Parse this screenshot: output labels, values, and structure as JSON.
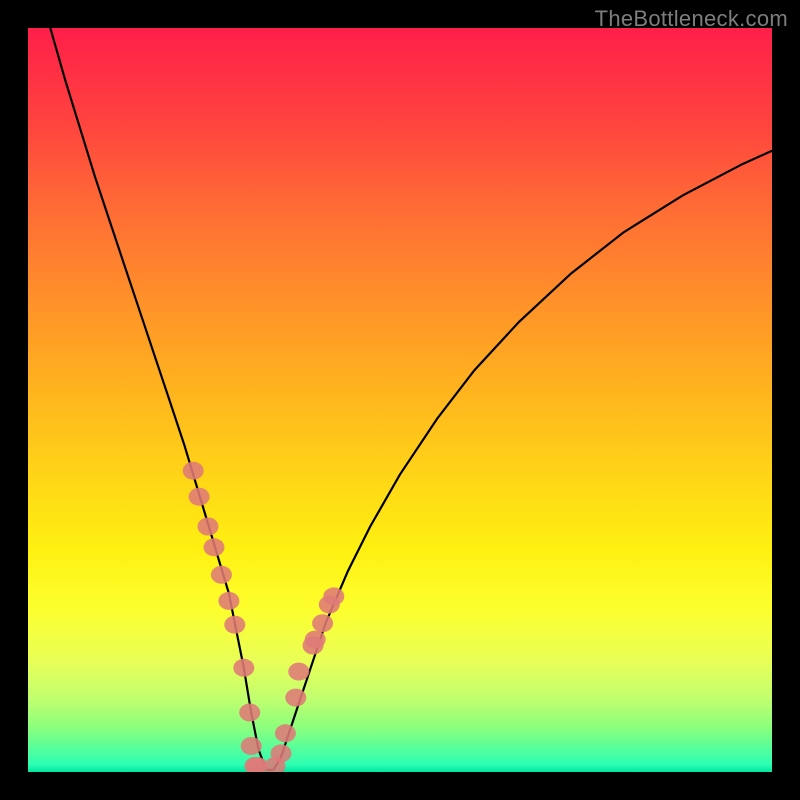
{
  "watermark": "TheBottleneck.com",
  "chart_data": {
    "type": "line",
    "title": "",
    "xlabel": "",
    "ylabel": "",
    "xlim": [
      0,
      100
    ],
    "ylim": [
      0,
      100
    ],
    "series": [
      {
        "name": "bottleneck-curve",
        "x": [
          3,
          5,
          7,
          9,
          11,
          13,
          15,
          17,
          19,
          21,
          22.5,
          24,
          25.5,
          27,
          28,
          29,
          30,
          31,
          32,
          33,
          34,
          36,
          38,
          40,
          43,
          46,
          50,
          55,
          60,
          66,
          73,
          80,
          88,
          96,
          100
        ],
        "y": [
          100,
          93,
          86.5,
          80,
          74,
          68,
          62,
          56,
          50,
          44,
          39,
          34,
          29,
          24,
          19,
          14,
          8,
          3,
          0.3,
          0.3,
          2,
          8,
          14,
          20,
          27,
          33,
          40,
          47.5,
          54,
          60.5,
          67,
          72.5,
          77.5,
          81.7,
          83.5
        ]
      }
    ],
    "marker_points": {
      "name": "highlighted-samples",
      "x": [
        22.2,
        23.0,
        24.2,
        25.0,
        26.0,
        27.0,
        27.8,
        29.0,
        29.8,
        30.0,
        30.5,
        30.8,
        33.2,
        34.0,
        34.6,
        36.0,
        36.4,
        38.3,
        38.6,
        39.6,
        40.5,
        41.1
      ],
      "y": [
        40.5,
        37.0,
        33.0,
        30.2,
        26.5,
        23.0,
        19.8,
        14.0,
        8.0,
        3.5,
        0.8,
        0.8,
        0.8,
        2.5,
        5.2,
        10.0,
        13.5,
        17.0,
        17.8,
        20.0,
        22.5,
        23.6
      ]
    }
  }
}
